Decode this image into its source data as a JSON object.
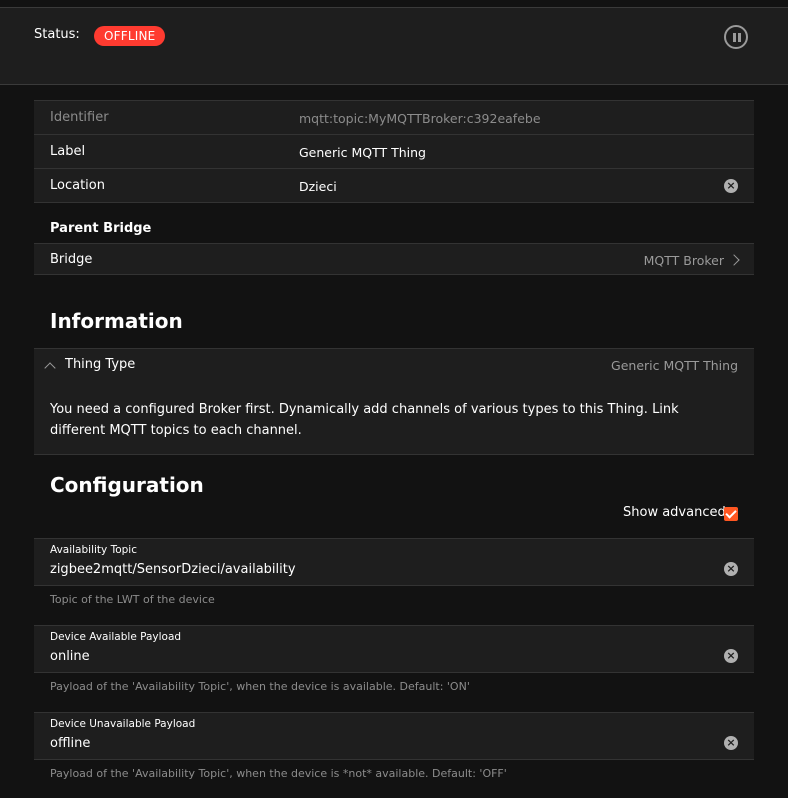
{
  "status": {
    "label": "Status:",
    "badge": "OFFLINE"
  },
  "properties": [
    {
      "label": "Identifier",
      "value": "mqtt:topic:MyMQTTBroker:c392eafebe"
    },
    {
      "label": "Label",
      "value": "Generic MQTT Thing"
    },
    {
      "label": "Location",
      "value": "Dzieci"
    }
  ],
  "parent_bridge": {
    "title": "Parent Bridge",
    "label": "Bridge",
    "value": "MQTT Broker"
  },
  "information": {
    "title": "Information",
    "thing_type_label": "Thing Type",
    "thing_type_value": "Generic MQTT Thing",
    "description": "You need a configured Broker first. Dynamically add channels of various types to this Thing. Link different MQTT topics to each channel."
  },
  "configuration": {
    "title": "Configuration",
    "show_advanced_label": "Show advanced",
    "show_advanced_checked": true,
    "fields": [
      {
        "label": "Availability Topic",
        "value": "zigbee2mqtt/SensorDzieci/availability",
        "info": "Topic of the LWT of the device"
      },
      {
        "label": "Device Available Payload",
        "value": "online",
        "info": "Payload of the 'Availability Topic', when the device is available. Default: 'ON'"
      },
      {
        "label": "Device Unavailable Payload",
        "value": "offline",
        "info": "Payload of the 'Availability Topic', when the device is *not* available. Default: 'OFF'"
      }
    ]
  },
  "icons": {
    "pause": "pause-circle-icon",
    "clear": "clear-circle-icon",
    "chevron_right": "chevron-right-icon",
    "chevron_up": "chevron-up-icon",
    "checkbox": "checkbox-checked-icon"
  },
  "colors": {
    "background": "#121212",
    "card": "#1e1e1e",
    "offline_badge": "#ff3b30",
    "checkbox_accent": "#ff5722"
  }
}
